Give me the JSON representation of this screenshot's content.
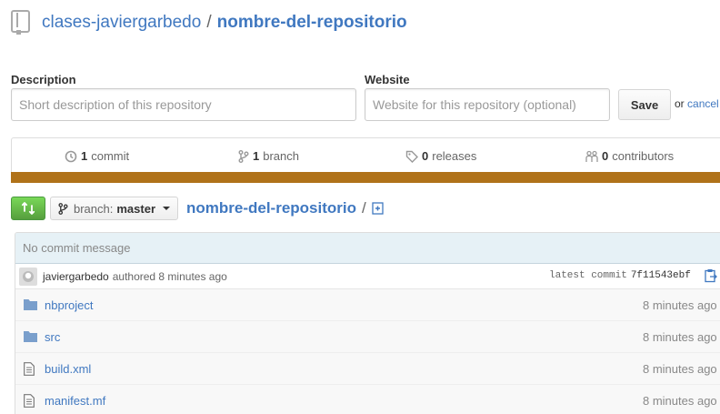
{
  "repo": {
    "owner": "clases-javiergarbedo",
    "separator": "/",
    "name": "nombre-del-repositorio"
  },
  "form": {
    "description_label": "Description",
    "description_placeholder": "Short description of this repository",
    "description_value": "",
    "website_label": "Website",
    "website_placeholder": "Website for this repository (optional)",
    "website_value": "",
    "save_label": "Save",
    "or_text": "or",
    "cancel_label": "cancel"
  },
  "summary": {
    "commits_count": "1",
    "commits_label": "commit",
    "branches_count": "1",
    "branches_label": "branch",
    "releases_count": "0",
    "releases_label": "releases",
    "contributors_count": "0",
    "contributors_label": "contributors",
    "language_color": "#b07219"
  },
  "file_nav": {
    "branch_prefix": "branch:",
    "branch_name": "master",
    "breadcrumb_repo": "nombre-del-repositorio",
    "breadcrumb_slash": "/"
  },
  "commit": {
    "message": "No commit message",
    "author": "javiergarbedo",
    "authored_text": "authored 8 minutes ago",
    "latest_label": "latest commit",
    "sha": "7f11543ebf"
  },
  "files": [
    {
      "name": "nbproject",
      "type": "folder",
      "age": "8 minutes ago",
      "icon": "folder-icon"
    },
    {
      "name": "src",
      "type": "folder",
      "age": "8 minutes ago",
      "icon": "folder-icon"
    },
    {
      "name": "build.xml",
      "type": "file",
      "age": "8 minutes ago",
      "icon": "file-icon"
    },
    {
      "name": "manifest.mf",
      "type": "file",
      "age": "8 minutes ago",
      "icon": "file-icon"
    }
  ],
  "colors": {
    "link": "#4078c0",
    "compare_button": "#6cc644"
  }
}
